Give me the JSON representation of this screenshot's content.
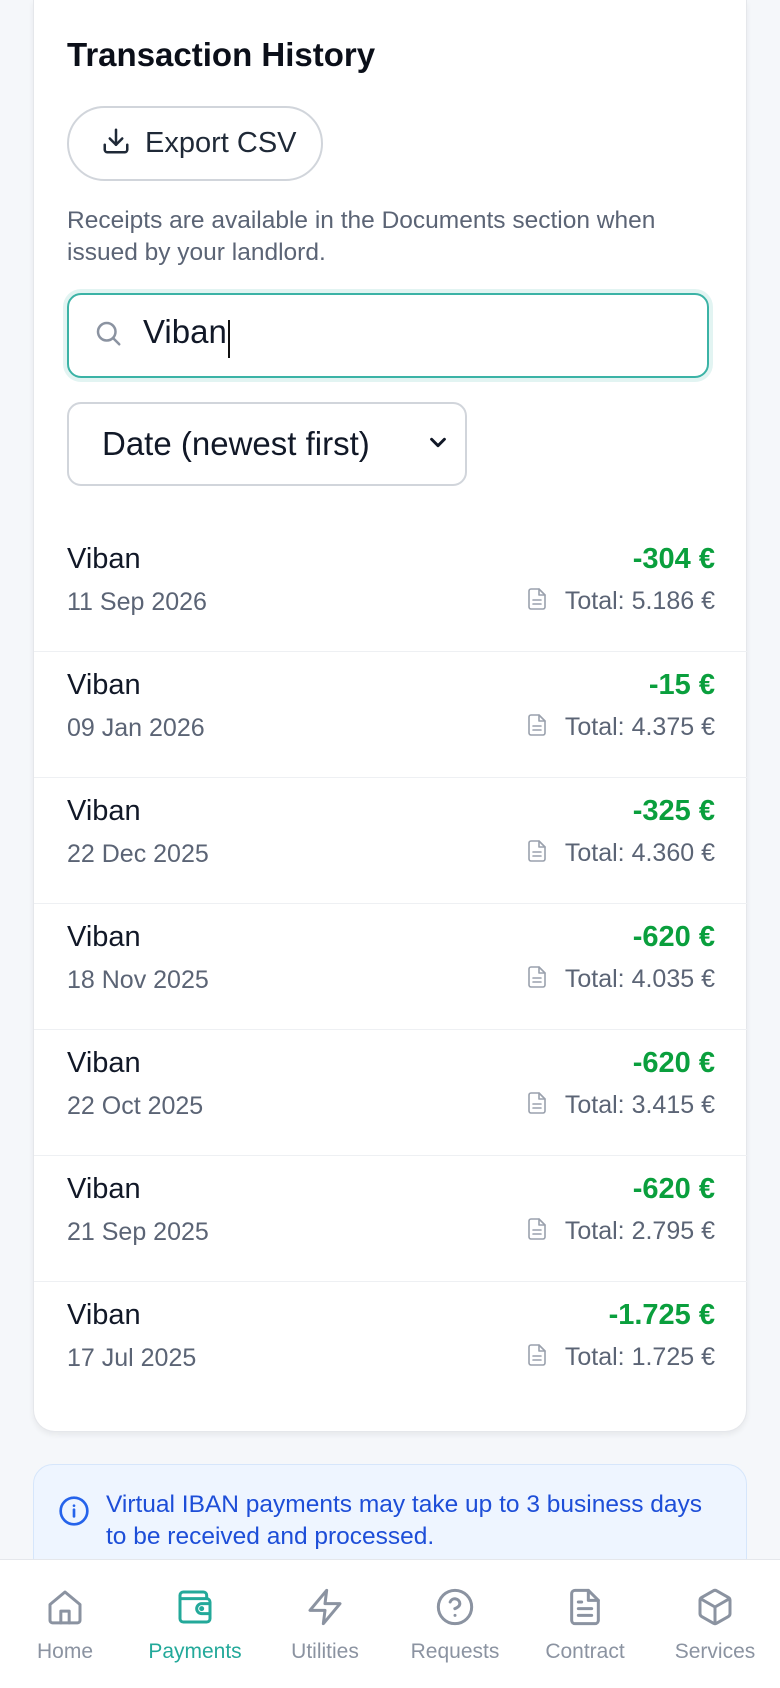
{
  "card": {
    "title": "Transaction History",
    "export_label": "Export CSV",
    "note": "Receipts are available in the Documents section when issued by your landlord.",
    "search": {
      "value": "Viban",
      "icon": "search-icon"
    },
    "sort": {
      "selected": "Date (newest first)"
    }
  },
  "transactions": [
    {
      "name": "Viban",
      "date": "11 Sep 2026",
      "amount": "-304 €",
      "total": "Total: 5.186 €"
    },
    {
      "name": "Viban",
      "date": "09 Jan 2026",
      "amount": "-15 €",
      "total": "Total: 4.375 €"
    },
    {
      "name": "Viban",
      "date": "22 Dec 2025",
      "amount": "-325 €",
      "total": "Total: 4.360 €"
    },
    {
      "name": "Viban",
      "date": "18 Nov 2025",
      "amount": "-620 €",
      "total": "Total: 4.035 €"
    },
    {
      "name": "Viban",
      "date": "22 Oct 2025",
      "amount": "-620 €",
      "total": "Total: 3.415 €"
    },
    {
      "name": "Viban",
      "date": "21 Sep 2025",
      "amount": "-620 €",
      "total": "Total: 2.795 €"
    },
    {
      "name": "Viban",
      "date": "17 Jul 2025",
      "amount": "-1.725 €",
      "total": "Total: 1.725 €"
    }
  ],
  "info": {
    "text": "Virtual IBAN payments may take up to 3 business days to be received and processed."
  },
  "nav": {
    "items": [
      {
        "label": "Home",
        "icon": "home-icon",
        "active": false
      },
      {
        "label": "Payments",
        "icon": "wallet-icon",
        "active": true
      },
      {
        "label": "Utilities",
        "icon": "lightning-icon",
        "active": false
      },
      {
        "label": "Requests",
        "icon": "help-circle-icon",
        "active": false
      },
      {
        "label": "Contract",
        "icon": "document-icon",
        "active": false
      },
      {
        "label": "Services",
        "icon": "package-icon",
        "active": false
      }
    ]
  },
  "colors": {
    "accent": "#23a99a",
    "amount": "#0a9f3d",
    "info_text": "#1d4ed8",
    "muted": "#5b6475"
  }
}
